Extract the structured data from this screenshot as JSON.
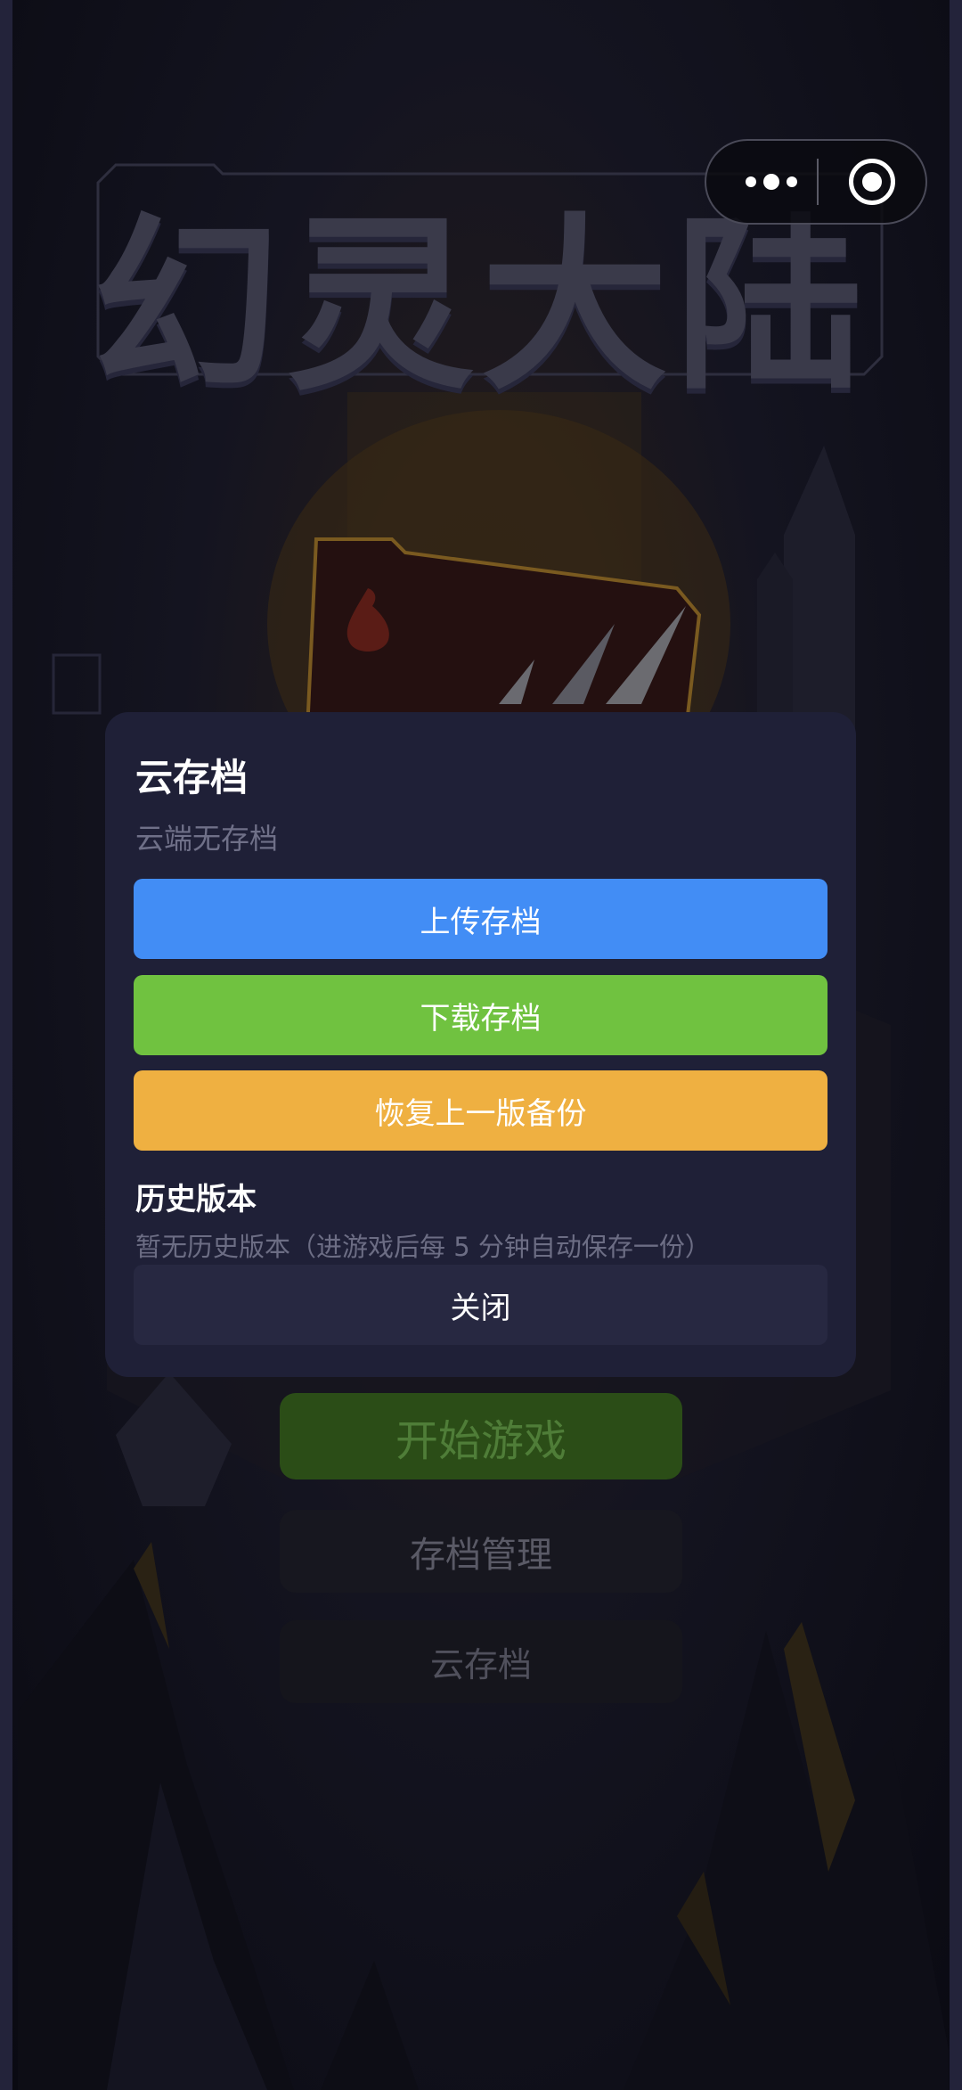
{
  "game": {
    "title": "幻灵大陆"
  },
  "menu": {
    "start_label": "开始游戏",
    "save_manage_label": "存档管理",
    "cloud_save_label": "云存档"
  },
  "dialog": {
    "title": "云存档",
    "subtitle": "云端无存档",
    "upload_label": "上传存档",
    "download_label": "下载存档",
    "restore_label": "恢复上一版备份",
    "history_title": "历史版本",
    "history_empty": "暂无历史版本（进游戏后每 5 分钟自动保存一份）",
    "close_label": "关闭"
  },
  "colors": {
    "dialog_bg": "#1f2037",
    "upload": "#428df5",
    "download": "#70c240",
    "restore": "#efb041",
    "close": "#272841"
  },
  "icons": [
    "more-icon",
    "target-icon",
    "flame-icon"
  ]
}
